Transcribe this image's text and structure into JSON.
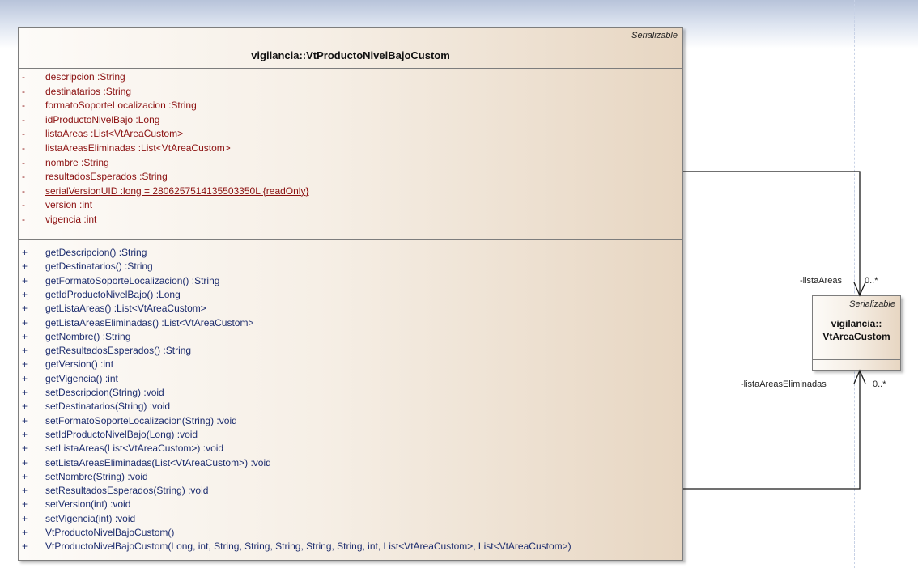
{
  "main_class": {
    "stereotype": "Serializable",
    "name": "vigilancia::VtProductoNivelBajoCustom",
    "attributes": [
      {
        "vis": "-",
        "text": "descripcion  :String"
      },
      {
        "vis": "-",
        "text": "destinatarios  :String"
      },
      {
        "vis": "-",
        "text": "formatoSoporteLocalizacion  :String"
      },
      {
        "vis": "-",
        "text": "idProductoNivelBajo  :Long"
      },
      {
        "vis": "-",
        "text": "listaAreas  :List<VtAreaCustom>"
      },
      {
        "vis": "-",
        "text": "listaAreasEliminadas  :List<VtAreaCustom>"
      },
      {
        "vis": "-",
        "text": "nombre  :String"
      },
      {
        "vis": "-",
        "text": "resultadosEsperados  :String"
      },
      {
        "vis": "-",
        "text": "serialVersionUID  :long = 2806257514135503350L {readOnly}"
      },
      {
        "vis": "-",
        "text": "version  :int"
      },
      {
        "vis": "-",
        "text": "vigencia  :int"
      }
    ],
    "operations": [
      {
        "vis": "+",
        "text": "getDescripcion()  :String"
      },
      {
        "vis": "+",
        "text": "getDestinatarios()  :String"
      },
      {
        "vis": "+",
        "text": "getFormatoSoporteLocalizacion()  :String"
      },
      {
        "vis": "+",
        "text": "getIdProductoNivelBajo()  :Long"
      },
      {
        "vis": "+",
        "text": "getListaAreas()  :List<VtAreaCustom>"
      },
      {
        "vis": "+",
        "text": "getListaAreasEliminadas()  :List<VtAreaCustom>"
      },
      {
        "vis": "+",
        "text": "getNombre()  :String"
      },
      {
        "vis": "+",
        "text": "getResultadosEsperados()  :String"
      },
      {
        "vis": "+",
        "text": "getVersion()  :int"
      },
      {
        "vis": "+",
        "text": "getVigencia()  :int"
      },
      {
        "vis": "+",
        "text": "setDescripcion(String)  :void"
      },
      {
        "vis": "+",
        "text": "setDestinatarios(String)  :void"
      },
      {
        "vis": "+",
        "text": "setFormatoSoporteLocalizacion(String)  :void"
      },
      {
        "vis": "+",
        "text": "setIdProductoNivelBajo(Long)  :void"
      },
      {
        "vis": "+",
        "text": "setListaAreas(List<VtAreaCustom>)  :void"
      },
      {
        "vis": "+",
        "text": "setListaAreasEliminadas(List<VtAreaCustom>)  :void"
      },
      {
        "vis": "+",
        "text": "setNombre(String)  :void"
      },
      {
        "vis": "+",
        "text": "setResultadosEsperados(String)  :void"
      },
      {
        "vis": "+",
        "text": "setVersion(int)  :void"
      },
      {
        "vis": "+",
        "text": "setVigencia(int)  :void"
      },
      {
        "vis": "+",
        "text": "VtProductoNivelBajoCustom()"
      },
      {
        "vis": "+",
        "text": "VtProductoNivelBajoCustom(Long, int, String, String, String, String, String, int, List<VtAreaCustom>, List<VtAreaCustom>)"
      }
    ]
  },
  "area_class": {
    "stereotype": "Serializable",
    "name_line1": "vigilancia::",
    "name_line2": "VtAreaCustom"
  },
  "associations": {
    "lista_areas": {
      "role": "-listaAreas",
      "multiplicity": "0..*"
    },
    "lista_areas_eliminadas": {
      "role": "-listaAreasEliminadas",
      "multiplicity": "0..*"
    }
  },
  "colors": {
    "attribute_text": "#8b1010",
    "operation_text": "#1c2c6e",
    "box_border": "#7d7d7d"
  }
}
